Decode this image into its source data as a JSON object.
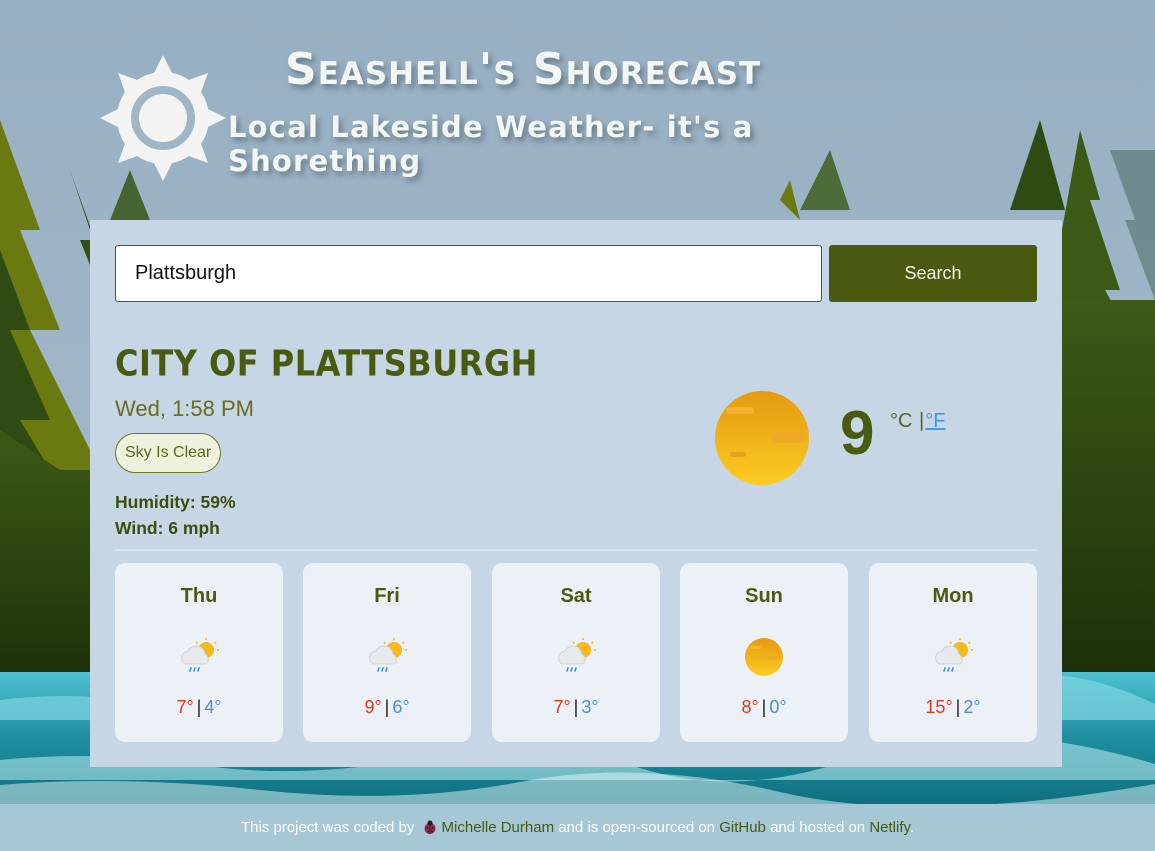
{
  "header": {
    "title": "Seashell's Shorecast",
    "subtitle": "Local Lakeside Weather- it's a Shorething",
    "logo_icon": "sun-icon"
  },
  "search": {
    "value": "Plattsburgh",
    "placeholder": "",
    "button_label": "Search"
  },
  "current": {
    "city": "City of Plattsburgh",
    "datetime": "Wed, 1:58 PM",
    "condition": "Sky Is Clear",
    "humidity": "Humidity: 59%",
    "wind": "Wind: 6 mph",
    "temperature": "9",
    "unit_c": "°C",
    "unit_sep": "|",
    "unit_f": "°F",
    "icon": "clear-sky-icon"
  },
  "forecast": [
    {
      "day": "Thu",
      "max": "7°",
      "min": "4°",
      "icon": "sun-rain-icon"
    },
    {
      "day": "Fri",
      "max": "9°",
      "min": "6°",
      "icon": "sun-rain-icon"
    },
    {
      "day": "Sat",
      "max": "7°",
      "min": "3°",
      "icon": "sun-rain-icon"
    },
    {
      "day": "Sun",
      "max": "8°",
      "min": "0°",
      "icon": "clear-sky-icon"
    },
    {
      "day": "Mon",
      "max": "15°",
      "min": "2°",
      "icon": "sun-rain-icon"
    }
  ],
  "footer": {
    "text_1": "This project was coded by",
    "author": "Michelle Durham",
    "text_2": "and is open-sourced on",
    "github": "GitHub",
    "text_3": "and hosted on",
    "netlify": "Netlify",
    "text_4": "."
  },
  "colors": {
    "accent": "#4a5a10",
    "card_bg": "#c6d6e5",
    "max_temp": "#e0351e",
    "min_temp": "#4a8ed1",
    "link": "#3a9fe0"
  }
}
